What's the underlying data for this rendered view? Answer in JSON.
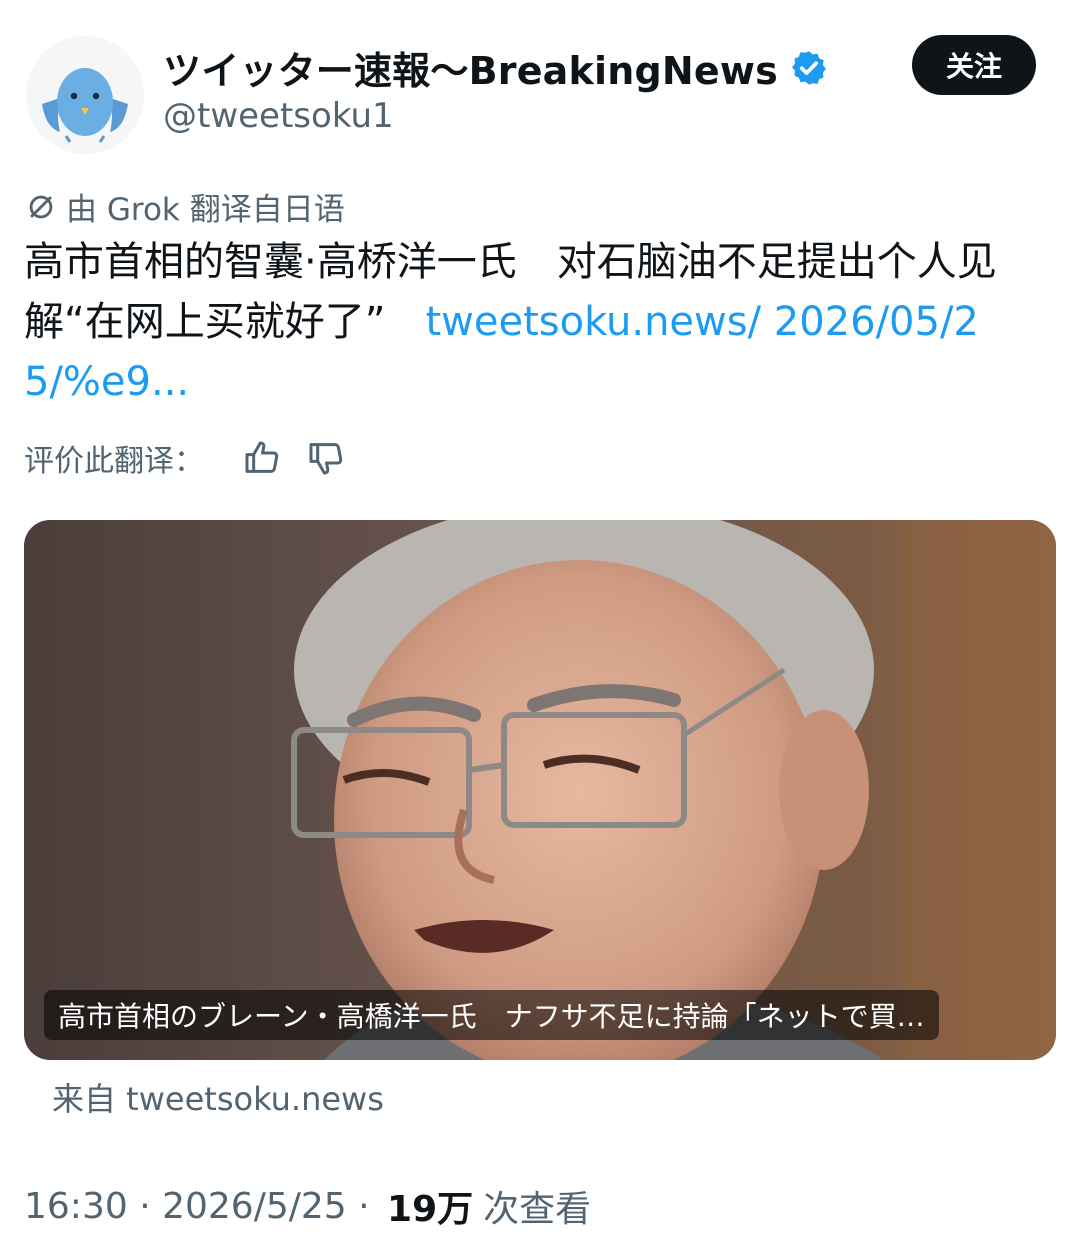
{
  "account": {
    "display_name": "ツイッター速報〜BreakingNews",
    "handle": "@tweetsoku1",
    "verified": true,
    "follow_label": "关注"
  },
  "translation": {
    "notice": "由 Grok 翻译自日语",
    "rate_label": "评价此翻译："
  },
  "tweet": {
    "text": "高市首相的智囊·高桥洋一氏　对石脑油不足提出个人见解“在网上买就好了”　",
    "link": "tweetsoku.news/ 2026/05/25/%e9..."
  },
  "card": {
    "title": "高市首相のブレーン・高橋洋一氏　ナフサ不足に持論「ネットで買…",
    "source": "来自 tweetsoku.news"
  },
  "meta": {
    "time": "16:30",
    "date": "2026/5/25",
    "views_count": "19万",
    "views_label": "次查看",
    "separator": " · "
  },
  "colors": {
    "text": "#0f1419",
    "secondary": "#536471",
    "link": "#1d9bf0",
    "follow_bg": "#0f1419"
  },
  "icons": [
    "avatar-bird-icon",
    "verified-badge-icon",
    "translate-icon",
    "thumbs-up-icon",
    "thumbs-down-icon"
  ]
}
